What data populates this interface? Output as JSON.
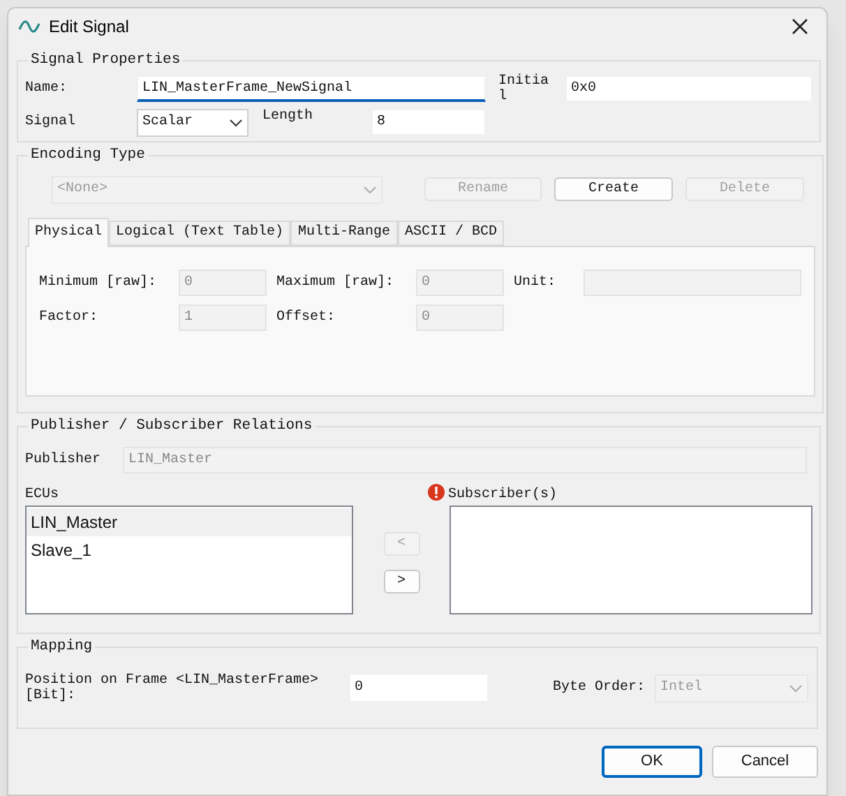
{
  "window": {
    "title": "Edit Signal"
  },
  "signal_properties": {
    "title": "Signal Properties",
    "name": {
      "label": "Name:",
      "value": "LIN_MasterFrame_NewSignal",
      "focused": true
    },
    "initial": {
      "label": "Initia\nl",
      "value": "0x0"
    },
    "signal": {
      "label": "Signal",
      "value": "Scalar"
    },
    "length": {
      "label": "Length",
      "value": "8"
    }
  },
  "encoding_type": {
    "title": "Encoding Type",
    "select": {
      "value": "<None>",
      "disabled": true
    },
    "buttons": [
      {
        "label": "Rename",
        "disabled": true
      },
      {
        "label": "Create",
        "disabled": false
      },
      {
        "label": "Delete",
        "disabled": true
      }
    ],
    "tabs": [
      {
        "label": "Physical",
        "selected": true
      },
      {
        "label": "Logical (Text Table)",
        "selected": false
      },
      {
        "label": "Multi-Range",
        "selected": false
      },
      {
        "label": "ASCII / BCD",
        "selected": false
      }
    ],
    "fields": [
      {
        "label": "Minimum [raw]:",
        "value": "0",
        "disabled": true
      },
      {
        "label": "Maximum [raw]:",
        "value": "0",
        "disabled": true
      },
      {
        "label": "Unit:",
        "disabled": true
      },
      {
        "label": "Factor:",
        "value": "1",
        "disabled": true
      },
      {
        "label": "Offset:",
        "value": "0",
        "disabled": true
      }
    ]
  },
  "relations": {
    "title": "Publisher / Subscriber Relations",
    "publisher": {
      "label": "Publisher",
      "value": "LIN_Master",
      "disabled": true
    },
    "ecus": {
      "label": "ECUs",
      "items": [
        {
          "label": "LIN_Master",
          "selected": true
        },
        {
          "label": "Slave_1",
          "selected": false
        }
      ]
    },
    "move_buttons": [
      {
        "label": "<",
        "disabled": true
      },
      {
        "label": ">",
        "disabled": false
      }
    ],
    "subscribers": {
      "label": "Subscriber(s)",
      "warning": true
    }
  },
  "mapping": {
    "title": "Mapping",
    "position": {
      "label": "Position on Frame <LIN_MasterFrame>\n[Bit]:",
      "value": "0"
    },
    "byte_order": {
      "label": "Byte Order:",
      "value": "Intel",
      "disabled": true
    }
  },
  "dialog_buttons": [
    {
      "label": "OK",
      "default": true
    },
    {
      "label": "Cancel",
      "default": false
    }
  ]
}
